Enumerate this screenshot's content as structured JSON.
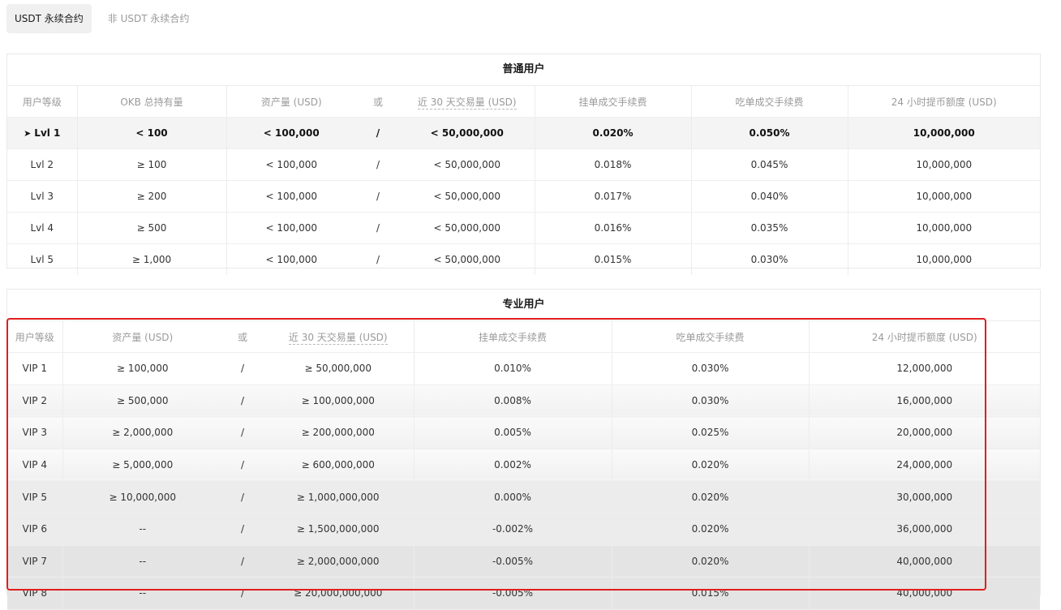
{
  "tabs": [
    {
      "label": "USDT 永续合约",
      "active": true
    },
    {
      "label": "非 USDT 永续合约",
      "active": false
    }
  ],
  "regular": {
    "title": "普通用户",
    "headers": [
      "用户等级",
      "OKB 总持有量",
      "资产量 (USD)",
      "或",
      "近 30 天交易量 (USD)",
      "挂单成交手续费",
      "吃单成交手续费",
      "24 小时提币额度 (USD)"
    ],
    "rows": [
      [
        "Lvl 1",
        "< 100",
        "< 100,000",
        "/",
        "< 50,000,000",
        "0.020%",
        "0.050%",
        "10,000,000"
      ],
      [
        "Lvl 2",
        "≥ 100",
        "< 100,000",
        "/",
        "< 50,000,000",
        "0.018%",
        "0.045%",
        "10,000,000"
      ],
      [
        "Lvl 3",
        "≥ 200",
        "< 100,000",
        "/",
        "< 50,000,000",
        "0.017%",
        "0.040%",
        "10,000,000"
      ],
      [
        "Lvl 4",
        "≥ 500",
        "< 100,000",
        "/",
        "< 50,000,000",
        "0.016%",
        "0.035%",
        "10,000,000"
      ],
      [
        "Lvl 5",
        "≥ 1,000",
        "< 100,000",
        "/",
        "< 50,000,000",
        "0.015%",
        "0.030%",
        "10,000,000"
      ]
    ]
  },
  "pro": {
    "title": "专业用户",
    "headers": [
      "用户等级",
      "资产量 (USD)",
      "或",
      "近 30 天交易量 (USD)",
      "挂单成交手续费",
      "吃单成交手续费",
      "24 小时提币额度 (USD)"
    ],
    "rows": [
      [
        "VIP 1",
        "≥ 100,000",
        "/",
        "≥ 50,000,000",
        "0.010%",
        "0.030%",
        "12,000,000"
      ],
      [
        "VIP 2",
        "≥ 500,000",
        "/",
        "≥ 100,000,000",
        "0.008%",
        "0.030%",
        "16,000,000"
      ],
      [
        "VIP 3",
        "≥ 2,000,000",
        "/",
        "≥ 200,000,000",
        "0.005%",
        "0.025%",
        "20,000,000"
      ],
      [
        "VIP 4",
        "≥ 5,000,000",
        "/",
        "≥ 600,000,000",
        "0.002%",
        "0.020%",
        "24,000,000"
      ],
      [
        "VIP 5",
        "≥ 10,000,000",
        "/",
        "≥ 1,000,000,000",
        "0.000%",
        "0.020%",
        "30,000,000"
      ],
      [
        "VIP 6",
        "--",
        "/",
        "≥ 1,500,000,000",
        "-0.002%",
        "0.020%",
        "36,000,000"
      ],
      [
        "VIP 7",
        "--",
        "/",
        "≥ 2,000,000,000",
        "-0.005%",
        "0.020%",
        "40,000,000"
      ],
      [
        "VIP 8",
        "--",
        "/",
        "≥ 20,000,000,000",
        "-0.005%",
        "0.015%",
        "40,000,000"
      ]
    ]
  },
  "colors": {
    "highlight_border": "#e01e1e"
  },
  "icons": {
    "current_level": "triangle-right-icon"
  }
}
